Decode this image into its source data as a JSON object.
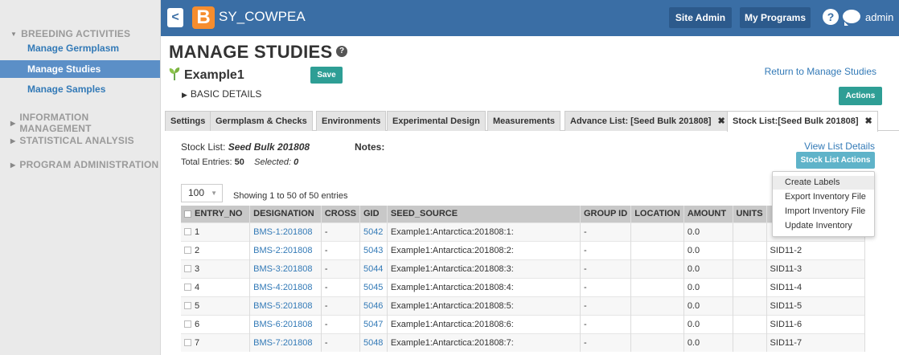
{
  "sidebar": {
    "sections": [
      {
        "label": "BREEDING ACTIVITIES",
        "expanded": true
      },
      {
        "label": "INFORMATION MANAGEMENT",
        "expanded": false
      },
      {
        "label": "STATISTICAL ANALYSIS",
        "expanded": false
      },
      {
        "label": "PROGRAM ADMINISTRATION",
        "expanded": false
      }
    ],
    "links": [
      "Manage Germplasm",
      "Manage Studies",
      "Manage Samples"
    ]
  },
  "topbar": {
    "back": "<",
    "logo": "B",
    "app_name": "SY_COWPEA",
    "site_admin": "Site Admin",
    "my_programs": "My Programs",
    "help": "?",
    "user": "admin"
  },
  "page": {
    "title": "MANAGE STUDIES",
    "title_help": "?",
    "study_name": "Example1",
    "save": "Save",
    "basic_details": "BASIC DETAILS",
    "return_link": "Return to Manage Studies",
    "actions": "Actions"
  },
  "tabs": [
    {
      "label": "Settings"
    },
    {
      "label": "Germplasm & Checks"
    },
    {
      "label": "Environments"
    },
    {
      "label": "Experimental Design"
    },
    {
      "label": "Measurements"
    },
    {
      "label": "Advance List: [Seed Bulk 201808]",
      "close": "✖"
    },
    {
      "label": "Stock List:[Seed Bulk 201808]",
      "close": "✖",
      "active": true
    }
  ],
  "stock": {
    "list_label": "Stock List:",
    "list_name": "Seed Bulk 201808",
    "notes_label": "Notes:",
    "total_label": "Total Entries:",
    "total_value": "50",
    "selected_label": "Selected:",
    "selected_value": "0",
    "view_details": "View List Details",
    "actions_btn": "Stock List Actions",
    "menu": [
      "Create Labels",
      "Export Inventory File",
      "Import Inventory File",
      "Update Inventory"
    ],
    "page_size": "100",
    "showing": "Showing 1 to 50 of 50 entries"
  },
  "table": {
    "headers": [
      "ENTRY_NO",
      "DESIGNATION",
      "CROSS",
      "GID",
      "SEED_SOURCE",
      "GROUP ID",
      "LOCATION",
      "AMOUNT",
      "UNITS",
      ""
    ],
    "rows": [
      [
        "1",
        "BMS-1:201808",
        "-",
        "5042",
        "Example1:Antarctica:201808:1:",
        "-",
        "",
        "0.0",
        "",
        ""
      ],
      [
        "2",
        "BMS-2:201808",
        "-",
        "5043",
        "Example1:Antarctica:201808:2:",
        "-",
        "",
        "0.0",
        "",
        "SID11-2"
      ],
      [
        "3",
        "BMS-3:201808",
        "-",
        "5044",
        "Example1:Antarctica:201808:3:",
        "-",
        "",
        "0.0",
        "",
        "SID11-3"
      ],
      [
        "4",
        "BMS-4:201808",
        "-",
        "5045",
        "Example1:Antarctica:201808:4:",
        "-",
        "",
        "0.0",
        "",
        "SID11-4"
      ],
      [
        "5",
        "BMS-5:201808",
        "-",
        "5046",
        "Example1:Antarctica:201808:5:",
        "-",
        "",
        "0.0",
        "",
        "SID11-5"
      ],
      [
        "6",
        "BMS-6:201808",
        "-",
        "5047",
        "Example1:Antarctica:201808:6:",
        "-",
        "",
        "0.0",
        "",
        "SID11-6"
      ],
      [
        "7",
        "BMS-7:201808",
        "-",
        "5048",
        "Example1:Antarctica:201808:7:",
        "-",
        "",
        "0.0",
        "",
        "SID11-7"
      ]
    ]
  },
  "colors": {
    "topbar": "#3a6ea5",
    "sidebar_active": "#5b8fc7",
    "teal_button": "#2e9e95",
    "stock_actions": "#5fb3c9",
    "logo": "#f68d2e"
  }
}
